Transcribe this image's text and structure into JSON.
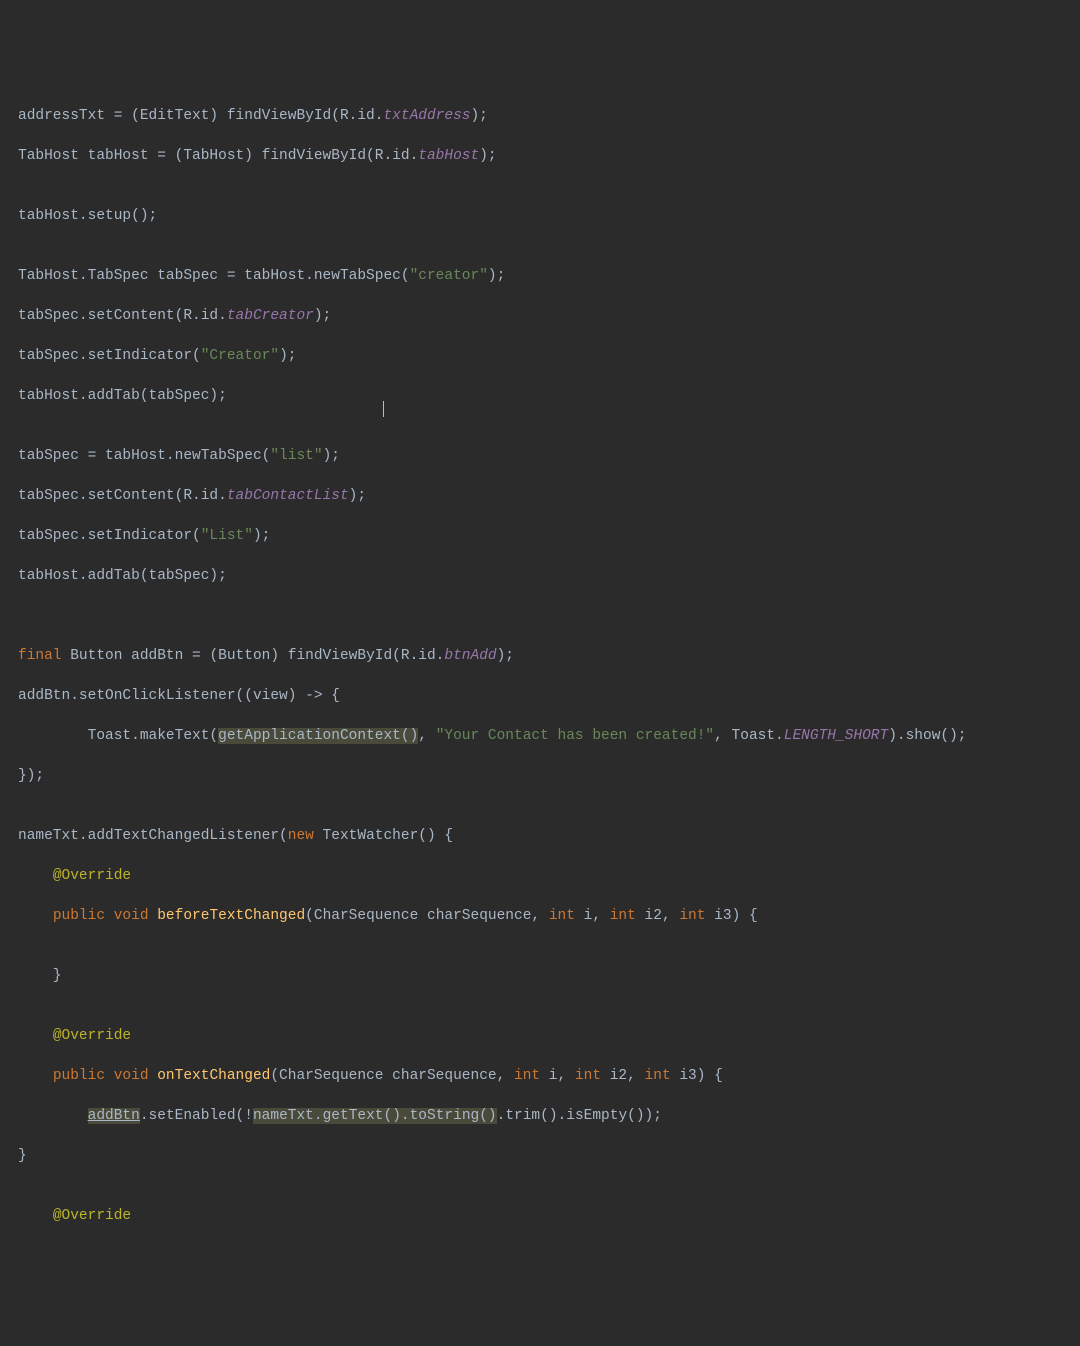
{
  "code": {
    "l1_a": "addressTxt = (EditText) findViewById(R.id.",
    "l1_b": "txtAddress",
    "l1_c": ");",
    "l2_a": "TabHost tabHost = (TabHost) findViewById(R.id.",
    "l2_b": "tabHost",
    "l2_c": ");",
    "l3": "",
    "l4": "tabHost.setup();",
    "l5": "",
    "l6_a": "TabHost.TabSpec tabSpec = tabHost.newTabSpec(",
    "l6_b": "\"creator\"",
    "l6_c": ");",
    "l7_a": "tabSpec.setContent(R.id.",
    "l7_b": "tabCreator",
    "l7_c": ");",
    "l8_a": "tabSpec.setIndicator(",
    "l8_b": "\"Creator\"",
    "l8_c": ");",
    "l9": "tabHost.addTab(tabSpec);",
    "l10": "",
    "l11_a": "tabSpec = tabHost.newTabSpec(",
    "l11_b": "\"list\"",
    "l11_c": ");",
    "l12_a": "tabSpec.setContent(R.id.",
    "l12_b": "tabContactList",
    "l12_c": ");",
    "l13_a": "tabSpec.setIndicator(",
    "l13_b": "\"List\"",
    "l13_c": ");",
    "l14": "tabHost.addTab(tabSpec);",
    "l15": "",
    "l16": "",
    "l17_a": "final",
    "l17_b": " Button addBtn = (Button) findViewById(R.id.",
    "l17_c": "btnAdd",
    "l17_d": ");",
    "l18": "addBtn.setOnClickListener((view) -> {",
    "l19_a": "        Toast.makeText(",
    "l19_b": "getApplicationContext()",
    "l19_c": ", ",
    "l19_d": "\"Your Contact has been created!\"",
    "l19_e": ", Toast.",
    "l19_f": "LENGTH_SHORT",
    "l19_g": ").show();",
    "l20": "});",
    "l21": "",
    "l22_a": "nameTxt.addTextChangedListener(",
    "l22_b": "new",
    "l22_c": " TextWatcher() {",
    "l23_a": "    ",
    "l23_b": "@Override",
    "l24_a": "    ",
    "l24_b": "public void",
    "l24_c": " ",
    "l24_d": "beforeTextChanged",
    "l24_e": "(CharSequence charSequence, ",
    "l24_f": "int",
    "l24_g": " i, ",
    "l24_h": "int",
    "l24_i": " i2, ",
    "l24_j": "int",
    "l24_k": " i3) {",
    "l25": "",
    "l26": "    }",
    "l27": "",
    "l28_a": "    ",
    "l28_b": "@Override",
    "l29_a": "    ",
    "l29_b": "public void",
    "l29_c": " ",
    "l29_d": "onTextChanged",
    "l29_e": "(CharSequence charSequence, ",
    "l29_f": "int",
    "l29_g": " i, ",
    "l29_h": "int",
    "l29_i": " i2, ",
    "l29_j": "int",
    "l29_k": " i3) {",
    "l30_a": "        ",
    "l30_b": "addBtn",
    "l30_c": ".setEnabled(!",
    "l30_d": "nameTxt",
    "l30_e": ".getText().toString()",
    "l30_f": ".trim().isEmpty());",
    "l31": "}",
    "l32": "",
    "l33_a": "    ",
    "l33_b": "@Override"
  }
}
